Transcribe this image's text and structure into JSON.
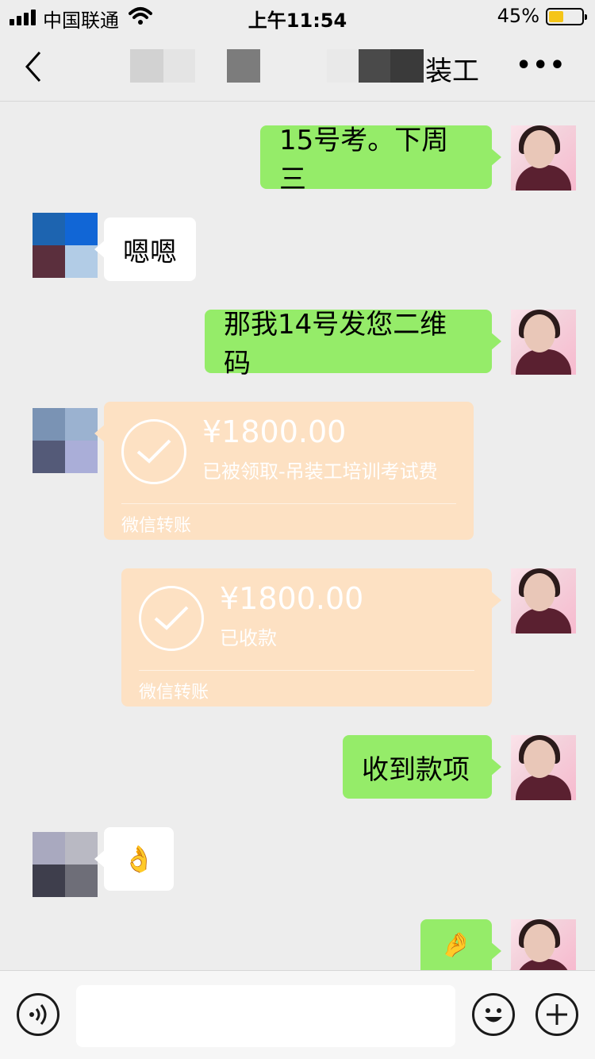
{
  "status_bar": {
    "carrier": "中国联通",
    "time": "上午11:54",
    "battery_percent": "45%",
    "battery_level": 0.45,
    "battery_color": "#f5c518"
  },
  "nav": {
    "title_visible_suffix": "装工",
    "back_icon": "chevron-left-icon",
    "more_icon": "more-dots-icon"
  },
  "messages": [
    {
      "from": "me",
      "type": "text",
      "text": "15号考。下周三"
    },
    {
      "from": "other",
      "type": "text",
      "text": "嗯嗯"
    },
    {
      "from": "me",
      "type": "text",
      "text": "那我14号发您二维码"
    },
    {
      "from": "other",
      "type": "transfer",
      "amount": "¥1800.00",
      "status": "已被领取-吊装工培训考试费",
      "footer": "微信转账"
    },
    {
      "from": "me",
      "type": "transfer",
      "amount": "¥1800.00",
      "status": "已收款",
      "footer": "微信转账"
    },
    {
      "from": "me",
      "type": "text",
      "text": "收到款项"
    },
    {
      "from": "other",
      "type": "emoji",
      "text": "👌"
    },
    {
      "from": "me",
      "type": "emoji",
      "text": "🤌"
    }
  ],
  "input_bar": {
    "voice_icon": "voice-icon",
    "emoji_icon": "emoji-face-icon",
    "add_icon": "plus-circle-icon"
  },
  "colors": {
    "background": "#ededed",
    "my_bubble": "#95ec69",
    "other_bubble": "#ffffff",
    "transfer_card": "#fde1c3"
  }
}
